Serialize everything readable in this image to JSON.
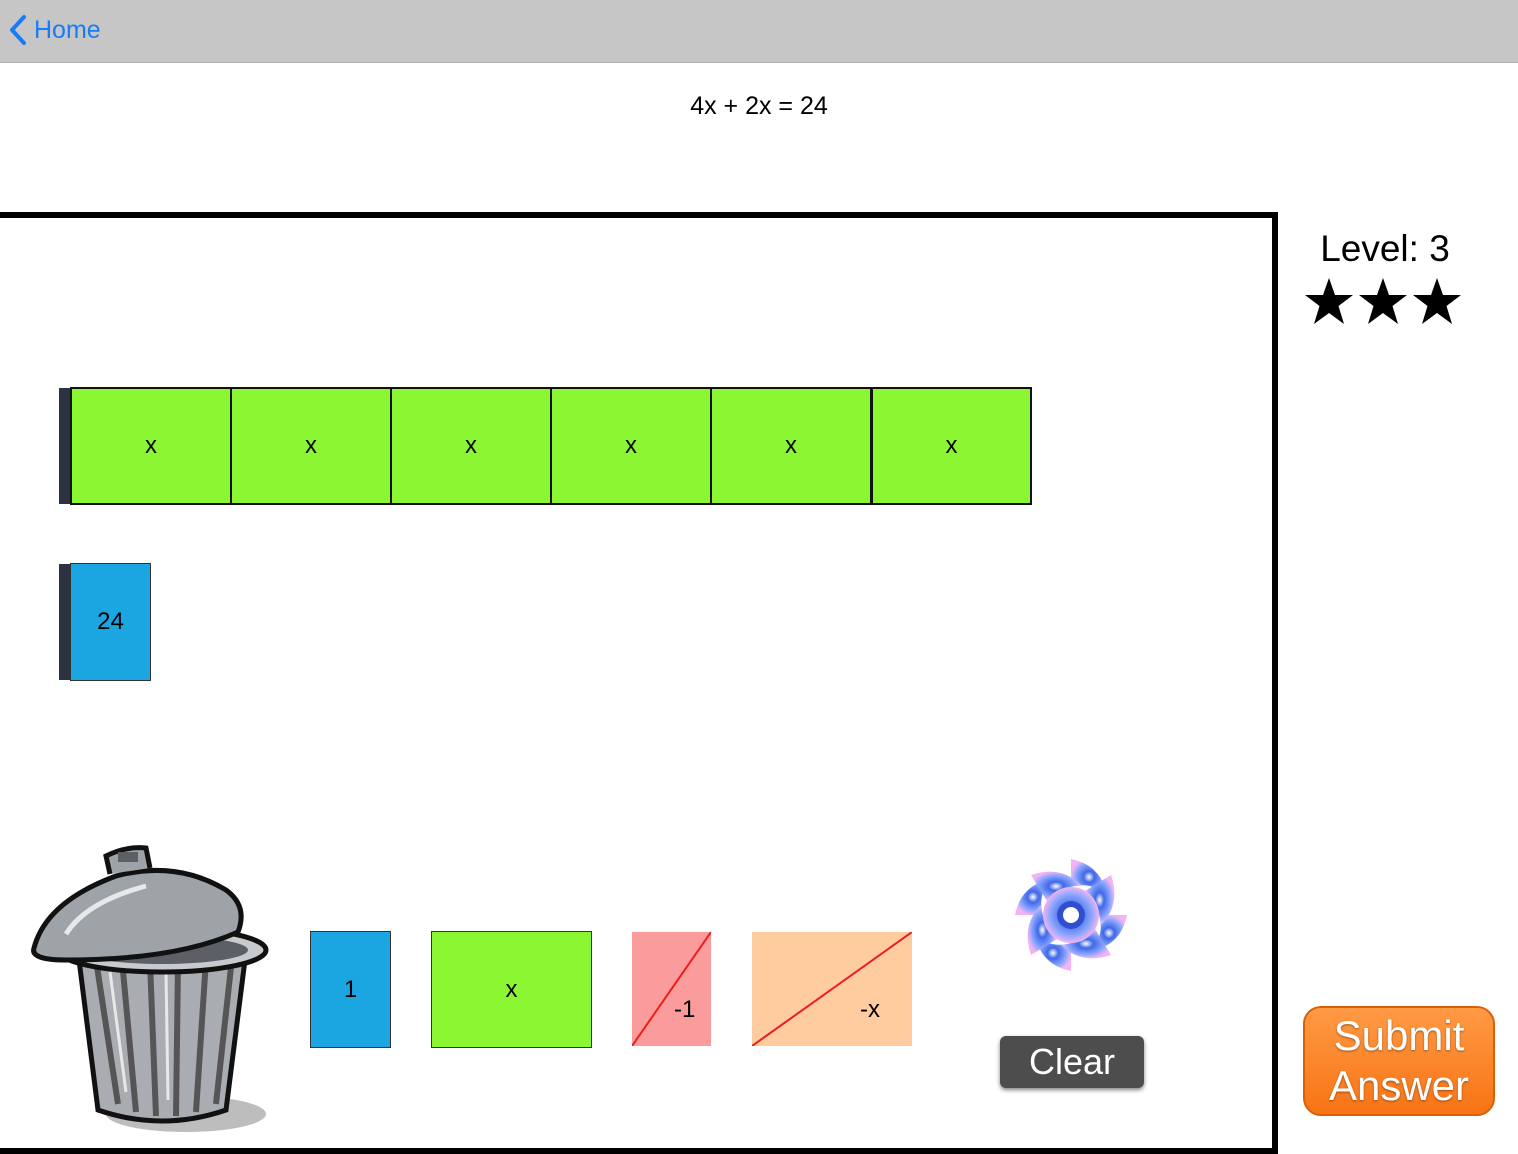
{
  "nav": {
    "back_label": "Home"
  },
  "equation": "4x + 2x = 24",
  "level": {
    "label": "Level: 3",
    "stars": 3
  },
  "board": {
    "row1_tiles": [
      "x",
      "x",
      "x",
      "x",
      "x",
      "x"
    ],
    "row2_tiles": [
      "24"
    ]
  },
  "palette": {
    "one": "1",
    "x": "x",
    "neg_one": "-1",
    "neg_x": "-x"
  },
  "buttons": {
    "clear": "Clear",
    "submit_line1": "Submit",
    "submit_line2": "Answer"
  },
  "colors": {
    "x_tile": "#8bf733",
    "unit_tile": "#1ba5e1",
    "neg_unit_tile": "#fb9c9c",
    "neg_x_tile": "#fecc9f",
    "submit": "#f87414",
    "back_link": "#1a7cf5"
  }
}
